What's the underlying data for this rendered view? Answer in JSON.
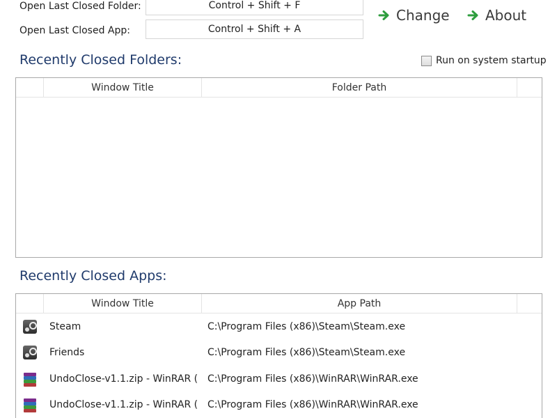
{
  "hotkeys": {
    "folder_label": "Open Last Closed Folder:",
    "folder_value": "Control + Shift + F",
    "app_label": "Open Last Closed App:",
    "app_value": "Control + Shift + A"
  },
  "actions": {
    "change_label": "Change",
    "about_label": "About",
    "arrow_color": "#2e9e3e"
  },
  "folders_section": {
    "title": "Recently Closed Folders:",
    "startup_label": "Run on system startup",
    "startup_checked": false,
    "columns": [
      "",
      "Window Title",
      "Folder Path",
      ""
    ],
    "rows": []
  },
  "apps_section": {
    "title": "Recently Closed Apps:",
    "columns": [
      "",
      "Window Title",
      "App Path",
      ""
    ],
    "rows": [
      {
        "icon": "steam-icon",
        "title": "Steam",
        "path": "C:\\Program Files (x86)\\Steam\\Steam.exe"
      },
      {
        "icon": "steam-icon",
        "title": "Friends",
        "path": "C:\\Program Files (x86)\\Steam\\Steam.exe"
      },
      {
        "icon": "winrar-icon",
        "title": "UndoClose-v1.1.zip - WinRAR (",
        "path": "C:\\Program Files (x86)\\WinRAR\\WinRAR.exe"
      },
      {
        "icon": "winrar-icon",
        "title": "UndoClose-v1.1.zip - WinRAR (",
        "path": "C:\\Program Files (x86)\\WinRAR\\WinRAR.exe"
      }
    ]
  }
}
